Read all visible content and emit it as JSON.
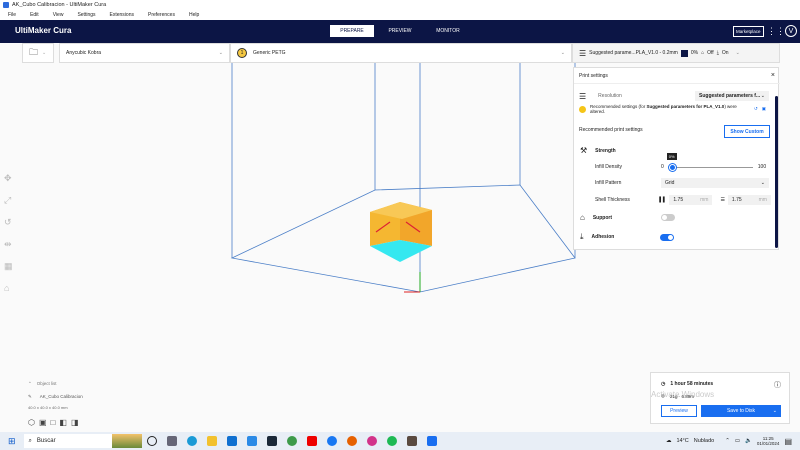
{
  "window": {
    "title": "AK_Cubo Calibracion - UltiMaker Cura"
  },
  "menu": [
    "File",
    "Edit",
    "View",
    "Settings",
    "Extensions",
    "Preferences",
    "Help"
  ],
  "header": {
    "logo": "UltiMaker Cura",
    "stages": [
      "PREPARE",
      "PREVIEW",
      "MONITOR"
    ],
    "marketplace": "Marketplace",
    "user_initial": "V"
  },
  "toolbar": {
    "printer": "Anycubic Kobra",
    "material_badge": "1",
    "material": "Generic PETG",
    "profile": "Suggested parame...PLA_V1.0 - 0.2mm",
    "infill": "0%",
    "support": "Off",
    "adhesion": "On"
  },
  "print_settings": {
    "title": "Print settings",
    "resolution_label": "Resolution",
    "resolution_value": "Suggested parameters f...",
    "warning_prefix": "Recommended settings (for ",
    "warning_bold": "Suggested parameters for PLA_V1.0",
    "warning_suffix": ") were altered.",
    "recommended_label": "Recommended print settings",
    "show_custom": "Show Custom",
    "strength": "Strength",
    "infill_density_label": "Infill Density",
    "infill_min": "0",
    "infill_max": "100",
    "infill_tooltip": "0%",
    "infill_value": 0,
    "infill_pattern_label": "Infill Pattern",
    "infill_pattern": "Grid",
    "shell_label": "Shell Thickness",
    "wall": "1.75",
    "wall_unit": "mm",
    "topbottom": "1.75",
    "topbottom_unit": "mm",
    "support": "Support",
    "support_on": false,
    "adhesion": "Adhesion",
    "adhesion_on": true
  },
  "object_list": {
    "label": "Object list",
    "object": "AK_Cubo Calibracion",
    "dims": "40.0 x 40.0 x 40.0 mm"
  },
  "estimate": {
    "time": "1 hour 58 minutes",
    "material": "21g · 6.89m",
    "preview": "Preview",
    "save": "Save to Disk",
    "watermark": "Activate Windows"
  },
  "taskbar": {
    "search": "Buscar",
    "temp": "14°C",
    "weather": "Nublado",
    "time": "11:25",
    "date": "01/01/2024"
  },
  "colors": {
    "navy": "#0c1545",
    "accent": "#196ef0",
    "model": "#f5b731"
  }
}
